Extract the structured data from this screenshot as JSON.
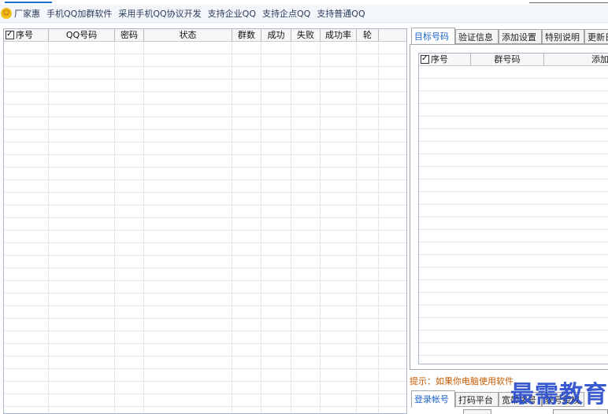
{
  "banner": {
    "logo_icon": "smile-icon",
    "items": [
      "厂家惠",
      "手机QQ加群软件",
      "采用手机QQ协议开发",
      "支持企业QQ",
      "支持企点QQ",
      "支持普通QQ"
    ]
  },
  "left_grid": {
    "columns": [
      "序号",
      "QQ号码",
      "密码",
      "状态",
      "群数",
      "成功",
      "失败",
      "成功率",
      "轮"
    ]
  },
  "right_tabs": [
    "目标号码",
    "验证信息",
    "添加设置",
    "特别说明",
    "更新日"
  ],
  "right_grid": {
    "columns": [
      "序号",
      "群号码",
      "添加"
    ]
  },
  "hint": "提示：如果你电脑使用软件，",
  "bottom_tabs": [
    "登录帐号",
    "打码平台",
    "宽带拨号",
    "获号授权"
  ],
  "watermark": "最需教育",
  "colors": {
    "accent": "#1e64c8",
    "hint": "#c55a00",
    "watermark": "#2a4ecb"
  }
}
